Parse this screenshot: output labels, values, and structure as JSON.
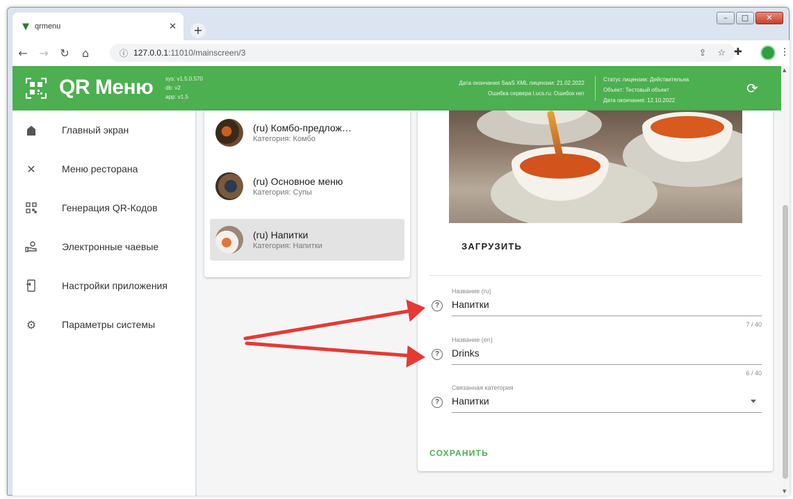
{
  "browser": {
    "tab_title": "qrmenu",
    "url_host": "127.0.0.1",
    "url_path": ":11010/mainscreen/3"
  },
  "header": {
    "logo_text": "QR Меню",
    "versions": [
      "sys: v1.5.0.570",
      "db: v2",
      "app: v1.5"
    ],
    "license_left": [
      "Дата окончания SaaS XML лицензии: 21.02.2022",
      "Ошибка сервера l.ucs.ru: Ошибок нет"
    ],
    "license_right": [
      "Статус лицензии: Действительна",
      "Объект: Тестовый объект",
      "Дата окончания: 12.10.2022"
    ]
  },
  "sidebar": {
    "items": [
      {
        "label": "Главный экран",
        "icon": "home-icon"
      },
      {
        "label": "Меню ресторана",
        "icon": "cutlery-icon"
      },
      {
        "label": "Генерация QR-Кодов",
        "icon": "qr-code-icon"
      },
      {
        "label": "Электронные чаевые",
        "icon": "tips-icon"
      },
      {
        "label": "Настройки приложения",
        "icon": "app-settings-icon"
      },
      {
        "label": "Параметры системы",
        "icon": "gear-icon"
      }
    ]
  },
  "categories": [
    {
      "name": "(ru) Комбо-предлож…",
      "category": "Категория: Комбо",
      "selected": false
    },
    {
      "name": "(ru) Основное меню",
      "category": "Категория: Супы",
      "selected": false
    },
    {
      "name": "(ru) Напитки",
      "category": "Категория: Напитки",
      "selected": true
    }
  ],
  "editor": {
    "upload_label": "ЗАГРУЗИТЬ",
    "fields": [
      {
        "label": "Название (ru)",
        "value": "Напитки",
        "counter": "7 / 40"
      },
      {
        "label": "Название (en)",
        "value": "Drinks",
        "counter": "6 / 40"
      },
      {
        "label": "Связанная категория",
        "value": "Напитки"
      }
    ],
    "save_label": "СОХРАНИТЬ"
  },
  "colors": {
    "brand_green": "#4caf50",
    "annotation_red": "#e53935"
  }
}
